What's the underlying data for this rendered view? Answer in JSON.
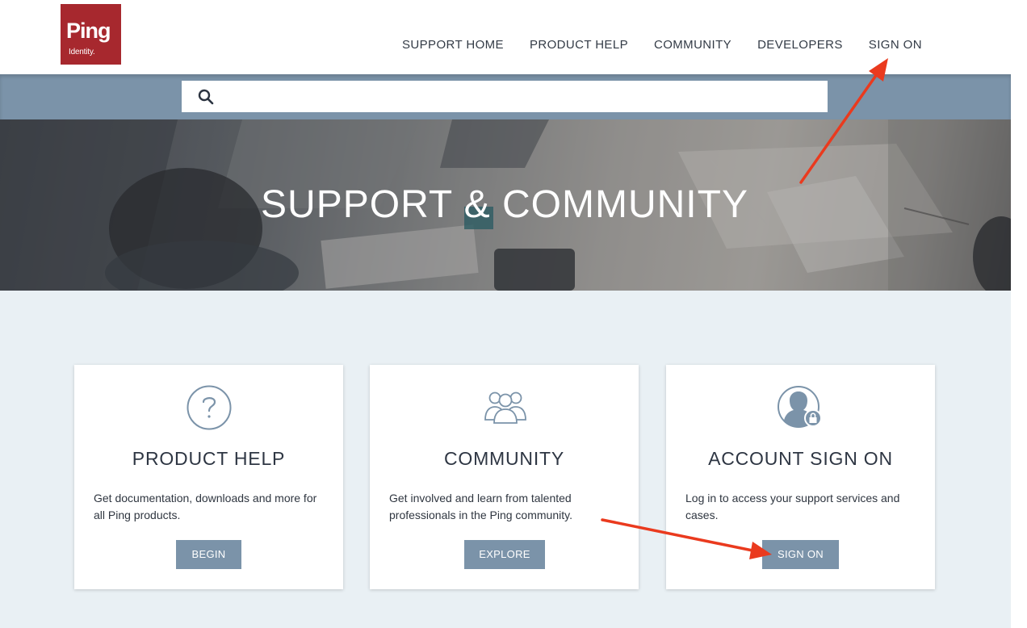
{
  "header": {
    "logo": {
      "main": "Ping",
      "sub": "Identity."
    },
    "nav": [
      {
        "label": "SUPPORT HOME"
      },
      {
        "label": "PRODUCT HELP"
      },
      {
        "label": "COMMUNITY"
      },
      {
        "label": "DEVELOPERS"
      },
      {
        "label": "SIGN ON"
      }
    ]
  },
  "search": {
    "placeholder": "",
    "value": "",
    "icon": "search-icon"
  },
  "hero": {
    "title": "SUPPORT & COMMUNITY"
  },
  "cards": [
    {
      "icon": "question-circle-icon",
      "title": "PRODUCT HELP",
      "description": "Get documentation, downloads and more for all Ping products.",
      "button": "BEGIN"
    },
    {
      "icon": "people-group-icon",
      "title": "COMMUNITY",
      "description": "Get involved and learn from talented professionals in the Ping community.",
      "button": "EXPLORE"
    },
    {
      "icon": "user-lock-icon",
      "title": "ACCOUNT SIGN ON",
      "description": "Log in to access your support services and cases.",
      "button": "SIGN ON"
    }
  ],
  "colors": {
    "brand_red": "#a7282e",
    "accent_slate": "#7b93a9",
    "page_bg": "#e9f0f4",
    "annotation_arrow": "#ea3a1e"
  }
}
